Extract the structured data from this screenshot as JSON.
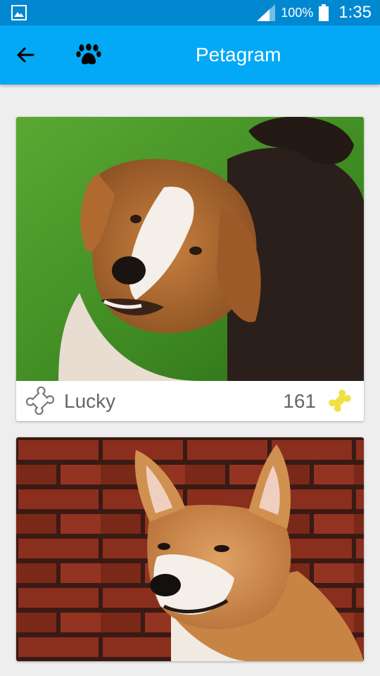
{
  "status_bar": {
    "battery_text": "100%",
    "time": "1:35",
    "icons": [
      "image-icon",
      "signal-icon",
      "battery-icon"
    ]
  },
  "app_bar": {
    "title": "Petagram",
    "icons": [
      "back-arrow-icon",
      "paw-icon"
    ]
  },
  "pets": [
    {
      "name": "Lucky",
      "rating": "161",
      "photo": "dog-photo",
      "icons": [
        "bone-outline-icon",
        "bone-yellow-icon"
      ]
    },
    {
      "photo": "dog-photo"
    }
  ],
  "colors": {
    "status_bar": "#0288d1",
    "app_bar": "#03a9f4",
    "bone_yellow": "#f0e040",
    "text_gray": "#666666"
  }
}
